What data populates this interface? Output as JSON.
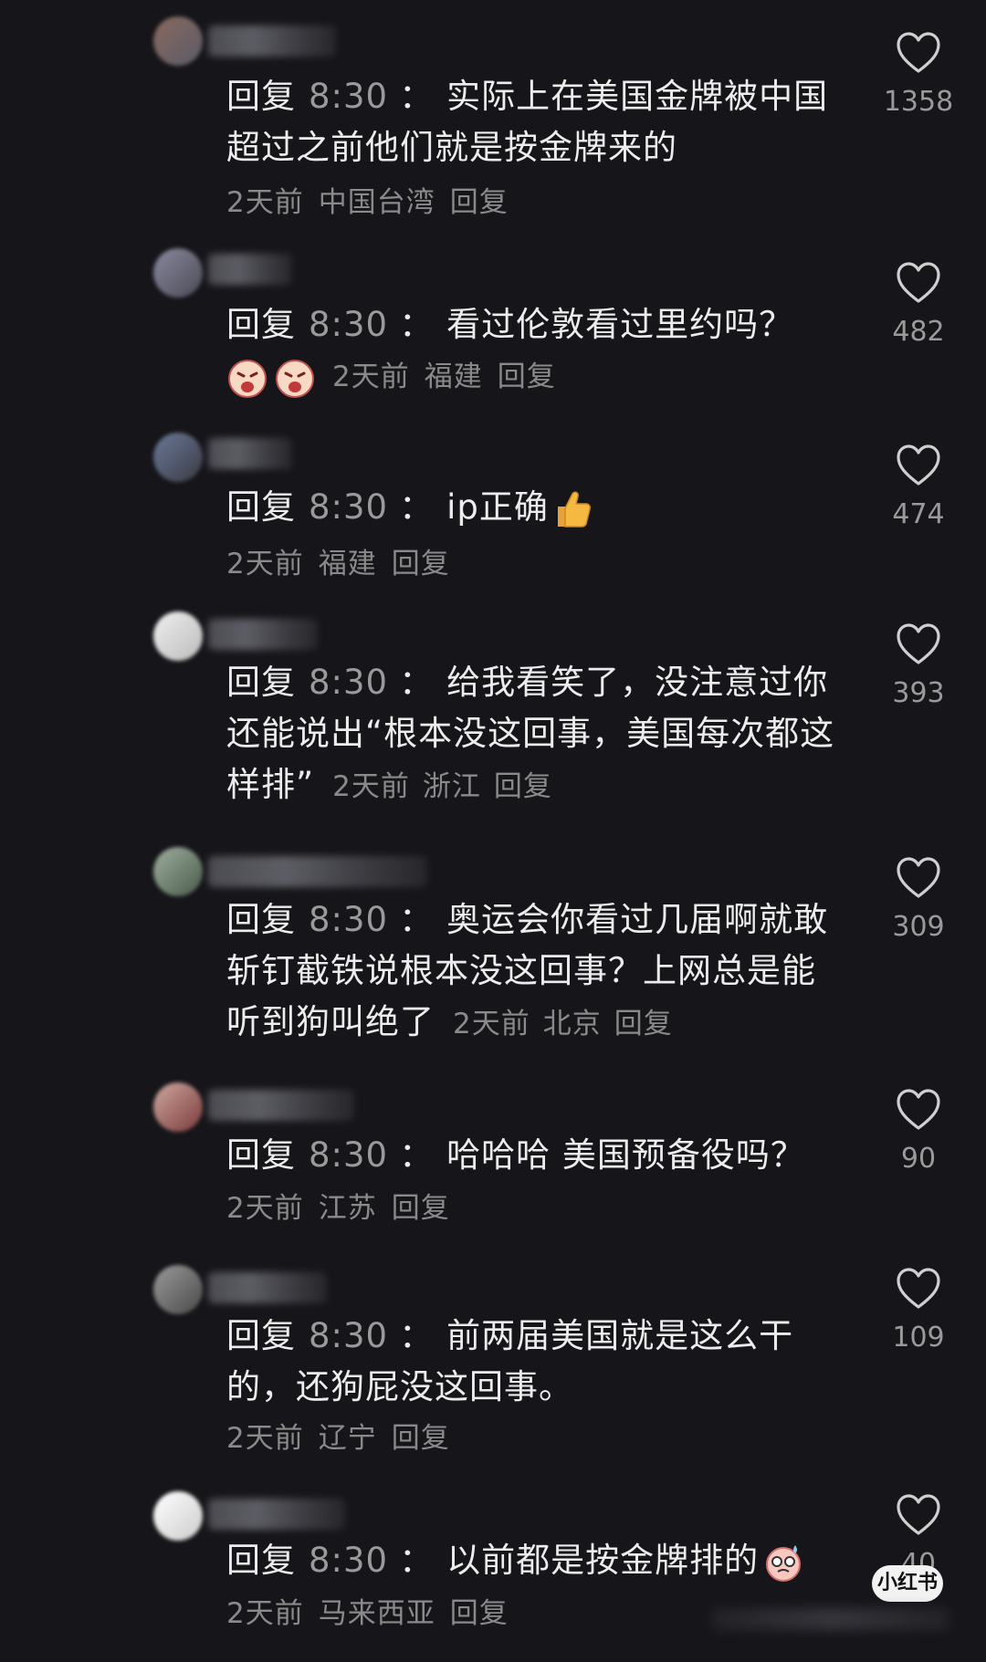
{
  "comments": [
    {
      "prefix": "回复",
      "time": "8:30",
      "colon": "：",
      "text": "实际上在美国金牌被中国超过之前他们就是按金牌来的",
      "when": "2天前",
      "place": "中国台湾",
      "reply": "回复",
      "likes": "1358"
    },
    {
      "prefix": "回复",
      "time": "8:30",
      "colon": "：",
      "text": "看过伦敦看过里约吗？",
      "when": "2天前",
      "place": "福建",
      "reply": "回复",
      "likes": "482",
      "emoji": "crying-face-emoji"
    },
    {
      "prefix": "回复",
      "time": "8:30",
      "colon": "：",
      "text": "ip正确",
      "when": "2天前",
      "place": "福建",
      "reply": "回复",
      "likes": "474",
      "emoji": "thumbs-up-emoji"
    },
    {
      "prefix": "回复",
      "time": "8:30",
      "colon": "：",
      "text": "给我看笑了，没注意过你还能说出“根本没这回事，美国每次都这样排”",
      "when": "2天前",
      "place": "浙江",
      "reply": "回复",
      "likes": "393"
    },
    {
      "prefix": "回复",
      "time": "8:30",
      "colon": "：",
      "text": "奥运会你看过几届啊就敢斩钉截铁说根本没这回事？上网总是能听到狗叫绝了",
      "when": "2天前",
      "place": "北京",
      "reply": "回复",
      "likes": "309"
    },
    {
      "prefix": "回复",
      "time": "8:30",
      "colon": "：",
      "text": "哈哈哈 美国预备役吗？",
      "when": "2天前",
      "place": "江苏",
      "reply": "回复",
      "likes": "90"
    },
    {
      "prefix": "回复",
      "time": "8:30",
      "colon": "：",
      "text": "前两届美国就是这么干的，还狗屁没这回事。",
      "when": "2天前",
      "place": "辽宁",
      "reply": "回复",
      "likes": "109"
    },
    {
      "prefix": "回复",
      "time": "8:30",
      "colon": "：",
      "text": "以前都是按金牌排的",
      "when": "2天前",
      "place": "马来西亚",
      "reply": "回复",
      "likes": "40",
      "emoji": "sweating-face-emoji"
    }
  ],
  "logo": "小红书",
  "colors": {
    "background": "#16161a",
    "text": "#ececec",
    "muted": "#8a8a8a"
  }
}
